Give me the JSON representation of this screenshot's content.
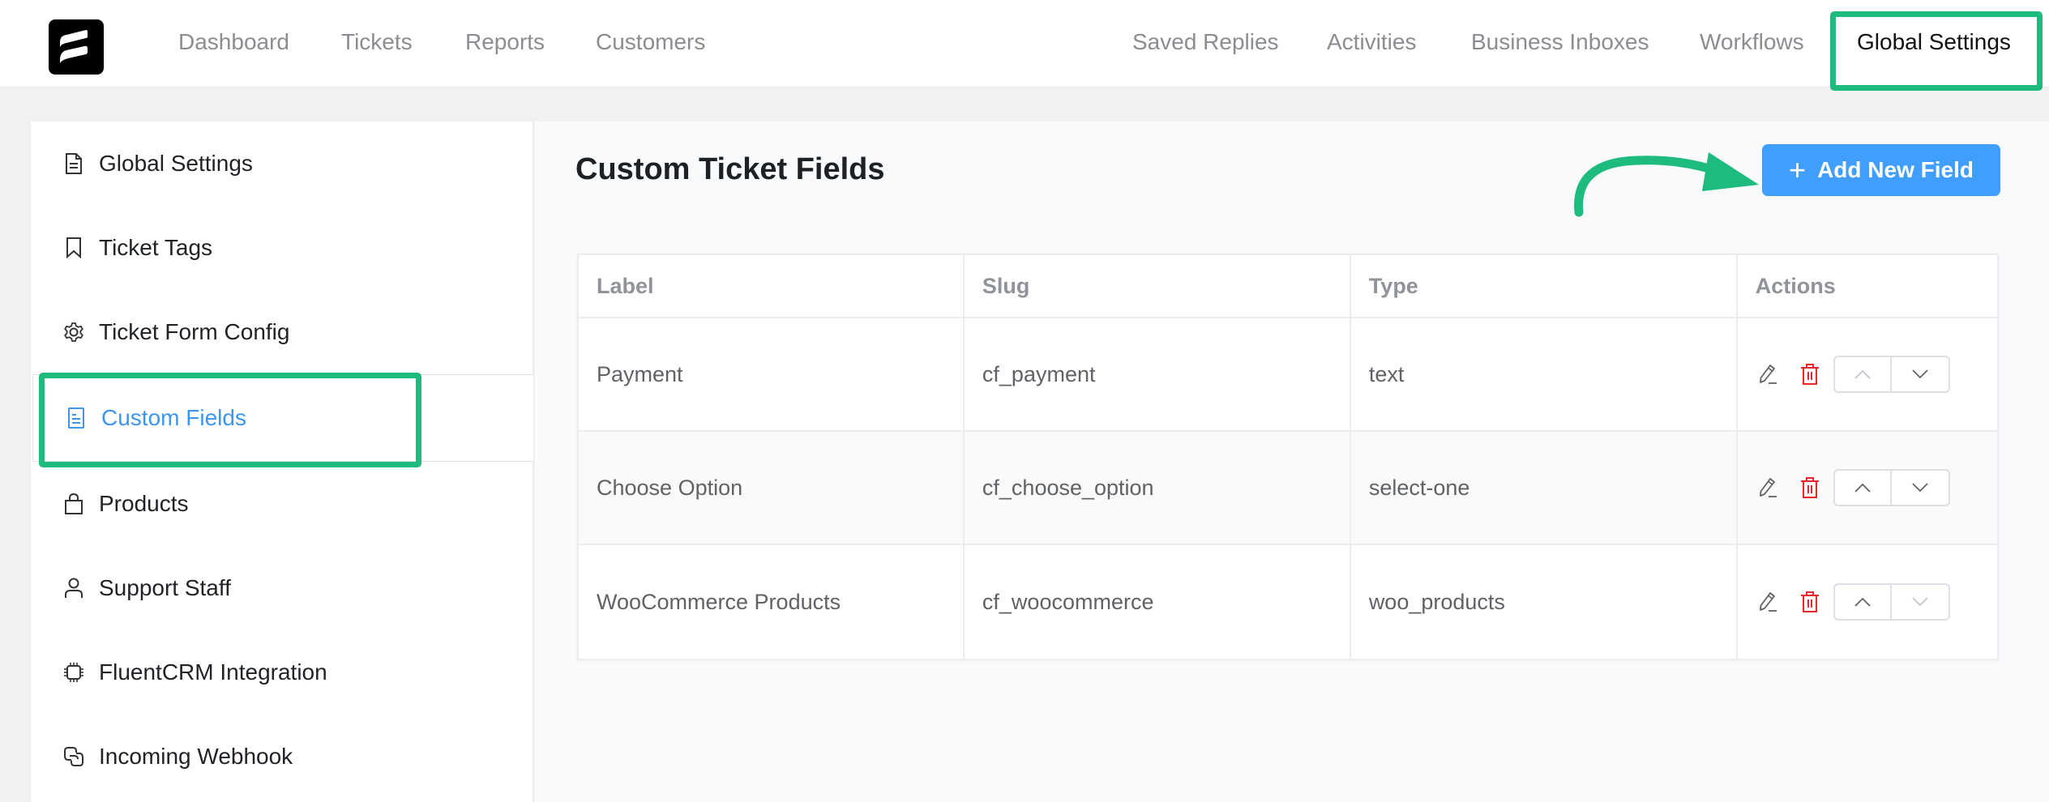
{
  "header": {
    "logo": "fluent-support-logo",
    "nav_left": [
      {
        "label": "Dashboard"
      },
      {
        "label": "Tickets"
      },
      {
        "label": "Reports"
      },
      {
        "label": "Customers"
      }
    ],
    "nav_right": [
      {
        "label": "Saved Replies"
      },
      {
        "label": "Activities"
      },
      {
        "label": "Business Inboxes"
      },
      {
        "label": "Workflows"
      },
      {
        "label": "Global Settings",
        "active": true
      }
    ]
  },
  "sidebar": {
    "items": [
      {
        "label": "Global Settings",
        "icon": "document-icon"
      },
      {
        "label": "Ticket Tags",
        "icon": "bookmark-icon"
      },
      {
        "label": "Ticket Form Config",
        "icon": "gear-icon"
      },
      {
        "label": "Custom Fields",
        "icon": "form-document-icon",
        "active": true
      },
      {
        "label": "Products",
        "icon": "shopping-bag-icon"
      },
      {
        "label": "Support Staff",
        "icon": "user-icon"
      },
      {
        "label": "FluentCRM Integration",
        "icon": "chip-icon"
      },
      {
        "label": "Incoming Webhook",
        "icon": "link-icon"
      }
    ]
  },
  "main": {
    "title": "Custom Ticket Fields",
    "add_button": {
      "plus": "+",
      "label": "Add New Field"
    },
    "table": {
      "columns": [
        "Label",
        "Slug",
        "Type",
        "Actions"
      ],
      "rows": [
        {
          "label": "Payment",
          "slug": "cf_payment",
          "type": "text",
          "up_disabled": true,
          "down_disabled": false
        },
        {
          "label": "Choose Option",
          "slug": "cf_choose_option",
          "type": "select-one",
          "up_disabled": false,
          "down_disabled": false
        },
        {
          "label": "WooCommerce Products",
          "slug": "cf_woocommerce",
          "type": "woo_products",
          "up_disabled": false,
          "down_disabled": true
        }
      ]
    }
  },
  "colors": {
    "accent": "#409eff",
    "active_link": "#3d96ee",
    "annotation": "#1dbb7d",
    "delete": "#e8262b"
  }
}
